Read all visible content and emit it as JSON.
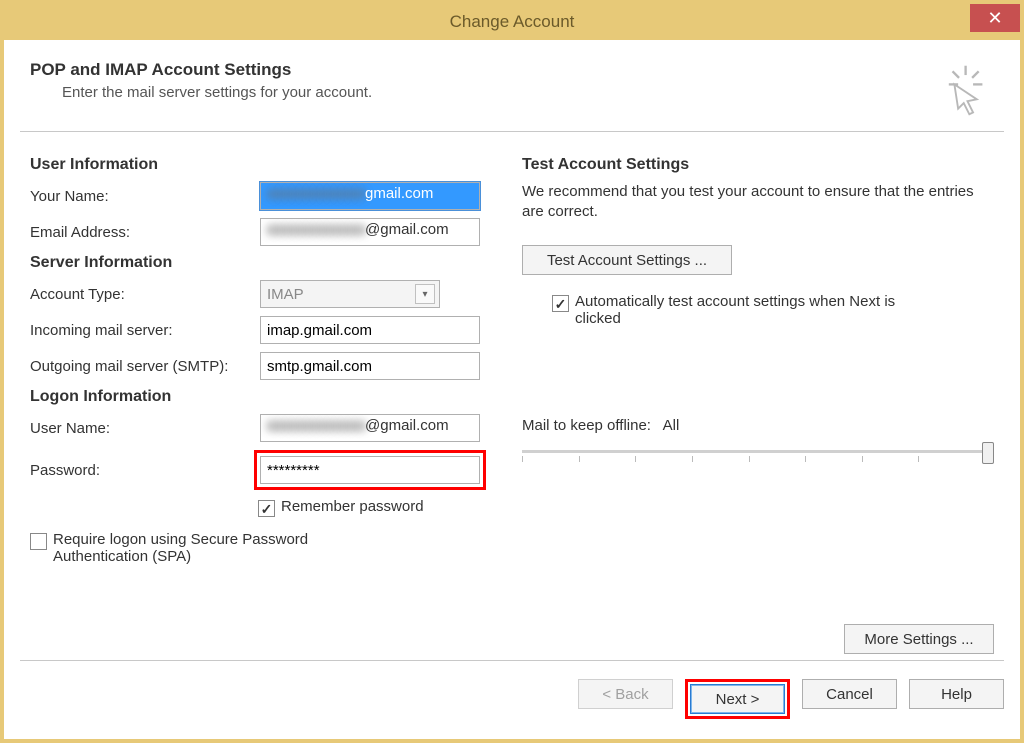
{
  "window": {
    "title": "Change Account",
    "close_glyph": "✕"
  },
  "header": {
    "title": "POP and IMAP Account Settings",
    "subtitle": "Enter the mail server settings for your account."
  },
  "sections": {
    "user_info": "User Information",
    "server_info": "Server Information",
    "logon_info": "Logon Information",
    "test_settings": "Test Account Settings"
  },
  "labels": {
    "your_name": "Your Name:",
    "email": "Email Address:",
    "account_type": "Account Type:",
    "incoming": "Incoming mail server:",
    "outgoing": "Outgoing mail server (SMTP):",
    "user_name": "User Name:",
    "password": "Password:",
    "remember_password": "Remember password",
    "spa": "Require logon using Secure Password Authentication (SPA)",
    "mail_offline": "Mail to keep offline:",
    "auto_test": "Automatically test account settings when Next is clicked"
  },
  "values": {
    "your_name": "gmail.com",
    "email_suffix": "@gmail.com",
    "account_type": "IMAP",
    "incoming": "imap.gmail.com",
    "outgoing": "smtp.gmail.com",
    "user_name_suffix": "@gmail.com",
    "password": "*********",
    "mail_offline": "All"
  },
  "right": {
    "desc": "We recommend that you test your account to ensure that the entries are correct."
  },
  "buttons": {
    "test": "Test Account Settings ...",
    "more": "More Settings ...",
    "back": "< Back",
    "next": "Next >",
    "cancel": "Cancel",
    "help": "Help"
  }
}
